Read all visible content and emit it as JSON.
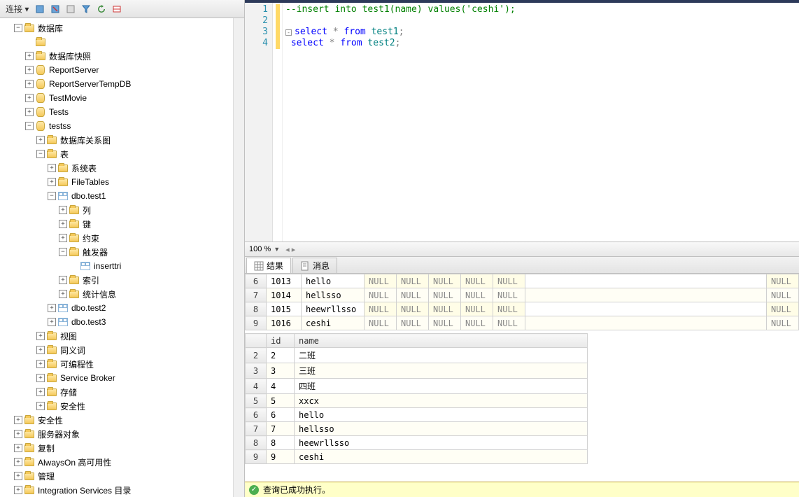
{
  "toolbar": {
    "label": "连接 ▾"
  },
  "tree": [
    {
      "d": 1,
      "e": "-",
      "i": "folder",
      "t": "数据库"
    },
    {
      "d": 2,
      "e": "",
      "i": "folder",
      "t": ""
    },
    {
      "d": 2,
      "e": "+",
      "i": "folder",
      "t": "数据库快照"
    },
    {
      "d": 2,
      "e": "+",
      "i": "cylinder",
      "t": "ReportServer"
    },
    {
      "d": 2,
      "e": "+",
      "i": "cylinder",
      "t": "ReportServerTempDB"
    },
    {
      "d": 2,
      "e": "+",
      "i": "cylinder",
      "t": "TestMovie"
    },
    {
      "d": 2,
      "e": "+",
      "i": "cylinder",
      "t": "Tests"
    },
    {
      "d": 2,
      "e": "-",
      "i": "cylinder",
      "t": "testss"
    },
    {
      "d": 3,
      "e": "+",
      "i": "folder",
      "t": "数据库关系图"
    },
    {
      "d": 3,
      "e": "-",
      "i": "folder",
      "t": "表"
    },
    {
      "d": 4,
      "e": "+",
      "i": "folder",
      "t": "系统表"
    },
    {
      "d": 4,
      "e": "+",
      "i": "folder",
      "t": "FileTables"
    },
    {
      "d": 4,
      "e": "-",
      "i": "tbl",
      "t": "dbo.test1"
    },
    {
      "d": 5,
      "e": "+",
      "i": "folder",
      "t": "列"
    },
    {
      "d": 5,
      "e": "+",
      "i": "folder",
      "t": "键"
    },
    {
      "d": 5,
      "e": "+",
      "i": "folder",
      "t": "约束"
    },
    {
      "d": 5,
      "e": "-",
      "i": "folder",
      "t": "触发器"
    },
    {
      "d": 6,
      "e": "",
      "i": "tbl",
      "t": "inserttri"
    },
    {
      "d": 5,
      "e": "+",
      "i": "folder",
      "t": "索引"
    },
    {
      "d": 5,
      "e": "+",
      "i": "folder",
      "t": "统计信息"
    },
    {
      "d": 4,
      "e": "+",
      "i": "tbl",
      "t": "dbo.test2"
    },
    {
      "d": 4,
      "e": "+",
      "i": "tbl",
      "t": "dbo.test3"
    },
    {
      "d": 3,
      "e": "+",
      "i": "folder",
      "t": "视图"
    },
    {
      "d": 3,
      "e": "+",
      "i": "folder",
      "t": "同义词"
    },
    {
      "d": 3,
      "e": "+",
      "i": "folder",
      "t": "可编程性"
    },
    {
      "d": 3,
      "e": "+",
      "i": "folder",
      "t": "Service Broker"
    },
    {
      "d": 3,
      "e": "+",
      "i": "folder",
      "t": "存储"
    },
    {
      "d": 3,
      "e": "+",
      "i": "folder",
      "t": "安全性"
    },
    {
      "d": 1,
      "e": "+",
      "i": "folder",
      "t": "安全性"
    },
    {
      "d": 1,
      "e": "+",
      "i": "folder",
      "t": "服务器对象"
    },
    {
      "d": 1,
      "e": "+",
      "i": "folder",
      "t": "复制"
    },
    {
      "d": 1,
      "e": "+",
      "i": "folder",
      "t": "AlwaysOn 高可用性"
    },
    {
      "d": 1,
      "e": "+",
      "i": "folder",
      "t": "管理"
    },
    {
      "d": 1,
      "e": "+",
      "i": "folder",
      "t": "Integration Services 目录"
    }
  ],
  "editor": {
    "lines": [
      {
        "n": "1",
        "html": "<span class='cmt'>--insert into test1(name) values('ceshi');</span>"
      },
      {
        "n": "2",
        "html": ""
      },
      {
        "n": "3",
        "html": "<span class='collapse-box'>-</span><span class='kw'>select</span> <span class='op'>*</span> <span class='kw'>from</span> <span class='ident'>test1</span><span class='op'>;</span>"
      },
      {
        "n": "4",
        "html": " <span class='kw'>select</span> <span class='op'>*</span> <span class='kw'>from</span> <span class='ident'>test2</span><span class='op'>;</span>"
      }
    ]
  },
  "zoom": "100 %",
  "tabs": {
    "results": "结果",
    "messages": "消息"
  },
  "grid1": {
    "rows": [
      {
        "rn": "6",
        "c": [
          "1013",
          "hello",
          "NULL",
          "NULL",
          "NULL",
          "NULL",
          "NULL",
          "",
          "NULL"
        ]
      },
      {
        "rn": "7",
        "c": [
          "1014",
          "hellsso",
          "NULL",
          "NULL",
          "NULL",
          "NULL",
          "NULL",
          "",
          "NULL"
        ]
      },
      {
        "rn": "8",
        "c": [
          "1015",
          "heewrllsso",
          "NULL",
          "NULL",
          "NULL",
          "NULL",
          "NULL",
          "",
          "NULL"
        ]
      },
      {
        "rn": "9",
        "c": [
          "1016",
          "ceshi",
          "NULL",
          "NULL",
          "NULL",
          "NULL",
          "NULL",
          "",
          "NULL"
        ]
      }
    ]
  },
  "grid2": {
    "headers": [
      "",
      "id",
      "name"
    ],
    "rows": [
      {
        "rn": "2",
        "c": [
          "2",
          "二班"
        ]
      },
      {
        "rn": "3",
        "c": [
          "3",
          "三班"
        ]
      },
      {
        "rn": "4",
        "c": [
          "4",
          "四班"
        ]
      },
      {
        "rn": "5",
        "c": [
          "5",
          "xxcx"
        ]
      },
      {
        "rn": "6",
        "c": [
          "6",
          "hello"
        ]
      },
      {
        "rn": "7",
        "c": [
          "7",
          "hellsso"
        ]
      },
      {
        "rn": "8",
        "c": [
          "8",
          "heewrllsso"
        ]
      },
      {
        "rn": "9",
        "c": [
          "9",
          "ceshi"
        ]
      }
    ]
  },
  "status": "查询已成功执行。"
}
